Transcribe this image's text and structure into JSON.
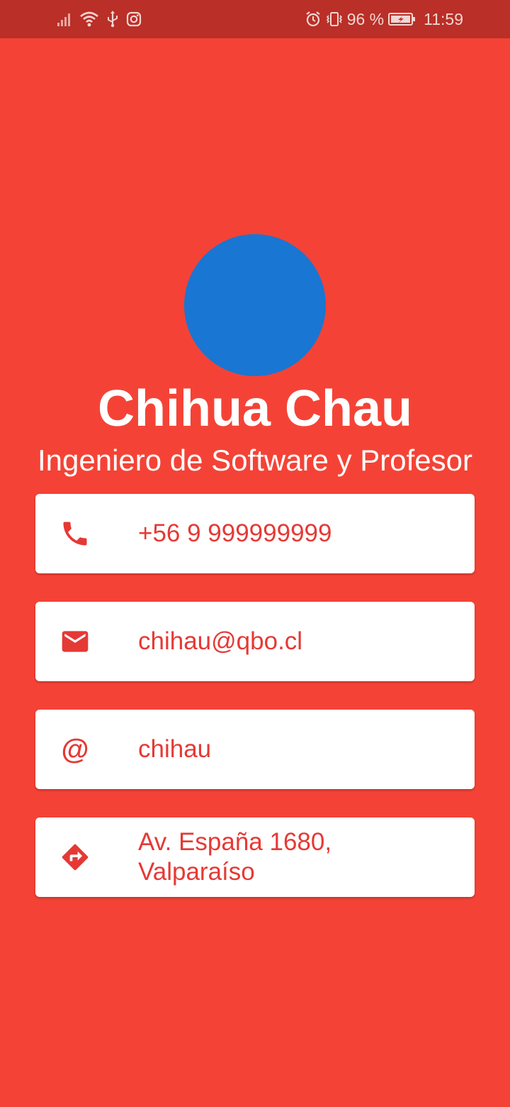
{
  "status_bar": {
    "battery_percent": "96 %",
    "time": "11:59",
    "battery_level": 0.96,
    "icons": [
      "signal-icon",
      "wifi-icon",
      "usb-icon",
      "instagram-icon",
      "alarm-icon",
      "vibrate-icon",
      "battery-charging-icon"
    ]
  },
  "profile": {
    "name": "Chihua Chau",
    "title": "Ingeniero de Software y Profesor",
    "avatar_color": "#1976d2"
  },
  "contacts": {
    "phone": {
      "icon": "phone-icon",
      "value": "+56 9 999999999"
    },
    "email": {
      "icon": "mail-icon",
      "value": "chihau@qbo.cl"
    },
    "handle": {
      "icon": "at-icon",
      "glyph": "@",
      "value": "chihau"
    },
    "address": {
      "icon": "directions-icon",
      "line1": "Av. España 1680,",
      "line2": "Valparaíso"
    }
  },
  "colors": {
    "background": "#f44336",
    "status_bar": "#ba2f27",
    "accent_text": "#e53935",
    "card": "#ffffff"
  }
}
